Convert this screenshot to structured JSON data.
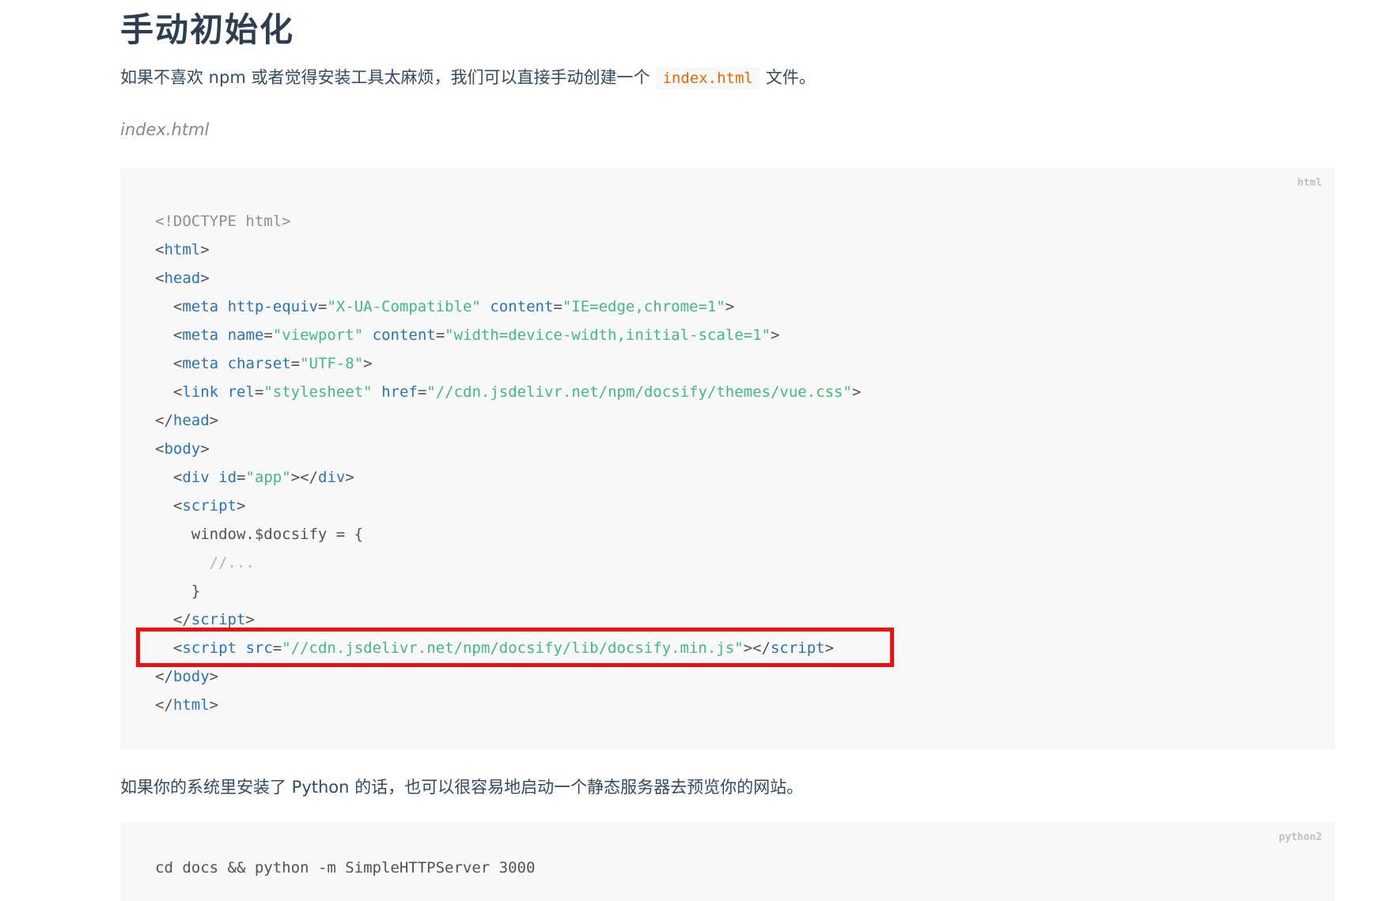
{
  "heading": "手动初始化",
  "intro": {
    "before": "如果不喜欢 npm 或者觉得安装工具太麻烦，我们可以直接手动创建一个",
    "code": "index.html",
    "after": "文件。"
  },
  "filename": "index.html",
  "code_block_1": {
    "lang": "html",
    "lines": [
      [
        {
          "t": "doctype",
          "v": "<!DOCTYPE html>"
        }
      ],
      [
        {
          "t": "punct",
          "v": "<"
        },
        {
          "t": "tag",
          "v": "html"
        },
        {
          "t": "punct",
          "v": ">"
        }
      ],
      [
        {
          "t": "punct",
          "v": "<"
        },
        {
          "t": "tag",
          "v": "head"
        },
        {
          "t": "punct",
          "v": ">"
        }
      ],
      [
        {
          "t": "plain",
          "v": "  "
        },
        {
          "t": "punct",
          "v": "<"
        },
        {
          "t": "tag",
          "v": "meta"
        },
        {
          "t": "plain",
          "v": " "
        },
        {
          "t": "attr",
          "v": "http-equiv"
        },
        {
          "t": "punct",
          "v": "="
        },
        {
          "t": "str",
          "v": "\"X-UA-Compatible\""
        },
        {
          "t": "plain",
          "v": " "
        },
        {
          "t": "attr",
          "v": "content"
        },
        {
          "t": "punct",
          "v": "="
        },
        {
          "t": "str",
          "v": "\"IE=edge,chrome=1\""
        },
        {
          "t": "punct",
          "v": ">"
        }
      ],
      [
        {
          "t": "plain",
          "v": "  "
        },
        {
          "t": "punct",
          "v": "<"
        },
        {
          "t": "tag",
          "v": "meta"
        },
        {
          "t": "plain",
          "v": " "
        },
        {
          "t": "attr",
          "v": "name"
        },
        {
          "t": "punct",
          "v": "="
        },
        {
          "t": "str",
          "v": "\"viewport\""
        },
        {
          "t": "plain",
          "v": " "
        },
        {
          "t": "attr",
          "v": "content"
        },
        {
          "t": "punct",
          "v": "="
        },
        {
          "t": "str",
          "v": "\"width=device-width,initial-scale=1\""
        },
        {
          "t": "punct",
          "v": ">"
        }
      ],
      [
        {
          "t": "plain",
          "v": "  "
        },
        {
          "t": "punct",
          "v": "<"
        },
        {
          "t": "tag",
          "v": "meta"
        },
        {
          "t": "plain",
          "v": " "
        },
        {
          "t": "attr",
          "v": "charset"
        },
        {
          "t": "punct",
          "v": "="
        },
        {
          "t": "str",
          "v": "\"UTF-8\""
        },
        {
          "t": "punct",
          "v": ">"
        }
      ],
      [
        {
          "t": "plain",
          "v": "  "
        },
        {
          "t": "punct",
          "v": "<"
        },
        {
          "t": "tag",
          "v": "link"
        },
        {
          "t": "plain",
          "v": " "
        },
        {
          "t": "attr",
          "v": "rel"
        },
        {
          "t": "punct",
          "v": "="
        },
        {
          "t": "str",
          "v": "\"stylesheet\""
        },
        {
          "t": "plain",
          "v": " "
        },
        {
          "t": "attr",
          "v": "href"
        },
        {
          "t": "punct",
          "v": "="
        },
        {
          "t": "str",
          "v": "\"//cdn.jsdelivr.net/npm/docsify/themes/vue.css\""
        },
        {
          "t": "punct",
          "v": ">"
        }
      ],
      [
        {
          "t": "punct",
          "v": "</"
        },
        {
          "t": "tag",
          "v": "head"
        },
        {
          "t": "punct",
          "v": ">"
        }
      ],
      [
        {
          "t": "punct",
          "v": "<"
        },
        {
          "t": "tag",
          "v": "body"
        },
        {
          "t": "punct",
          "v": ">"
        }
      ],
      [
        {
          "t": "plain",
          "v": "  "
        },
        {
          "t": "punct",
          "v": "<"
        },
        {
          "t": "tag",
          "v": "div"
        },
        {
          "t": "plain",
          "v": " "
        },
        {
          "t": "attr",
          "v": "id"
        },
        {
          "t": "punct",
          "v": "="
        },
        {
          "t": "str",
          "v": "\"app\""
        },
        {
          "t": "punct",
          "v": "></"
        },
        {
          "t": "tag",
          "v": "div"
        },
        {
          "t": "punct",
          "v": ">"
        }
      ],
      [
        {
          "t": "plain",
          "v": "  "
        },
        {
          "t": "punct",
          "v": "<"
        },
        {
          "t": "tag",
          "v": "script"
        },
        {
          "t": "punct",
          "v": ">"
        }
      ],
      [
        {
          "t": "plain",
          "v": "    window.$docsify = {"
        }
      ],
      [
        {
          "t": "plain",
          "v": "      "
        },
        {
          "t": "comment",
          "v": "//..."
        }
      ],
      [
        {
          "t": "plain",
          "v": "    }"
        }
      ],
      [
        {
          "t": "plain",
          "v": "  "
        },
        {
          "t": "punct",
          "v": "</"
        },
        {
          "t": "tag",
          "v": "script"
        },
        {
          "t": "punct",
          "v": ">"
        }
      ],
      [
        {
          "t": "plain",
          "v": "  "
        },
        {
          "t": "punct",
          "v": "<"
        },
        {
          "t": "tag",
          "v": "script"
        },
        {
          "t": "plain",
          "v": " "
        },
        {
          "t": "attr",
          "v": "src"
        },
        {
          "t": "punct",
          "v": "="
        },
        {
          "t": "str",
          "v": "\"//cdn.jsdelivr.net/npm/docsify/lib/docsify.min.js\""
        },
        {
          "t": "punct",
          "v": "></"
        },
        {
          "t": "tag",
          "v": "script"
        },
        {
          "t": "punct",
          "v": ">"
        }
      ],
      [
        {
          "t": "punct",
          "v": "</"
        },
        {
          "t": "tag",
          "v": "body"
        },
        {
          "t": "punct",
          "v": ">"
        }
      ],
      [
        {
          "t": "punct",
          "v": "</"
        },
        {
          "t": "tag",
          "v": "html"
        },
        {
          "t": "punct",
          "v": ">"
        }
      ]
    ]
  },
  "python_note": "如果你的系统里安装了 Python 的话，也可以很容易地启动一个静态服务器去预览你的网站。",
  "code_block_2": {
    "lang": "python2",
    "lines": [
      [
        {
          "t": "plain",
          "v": "cd docs && python -m SimpleHTTPServer 3000"
        }
      ]
    ]
  },
  "colors": {
    "highlight_border": "#ee1111",
    "inline_code": "#e96900",
    "tag": "#2973b7",
    "string": "#42b983"
  }
}
